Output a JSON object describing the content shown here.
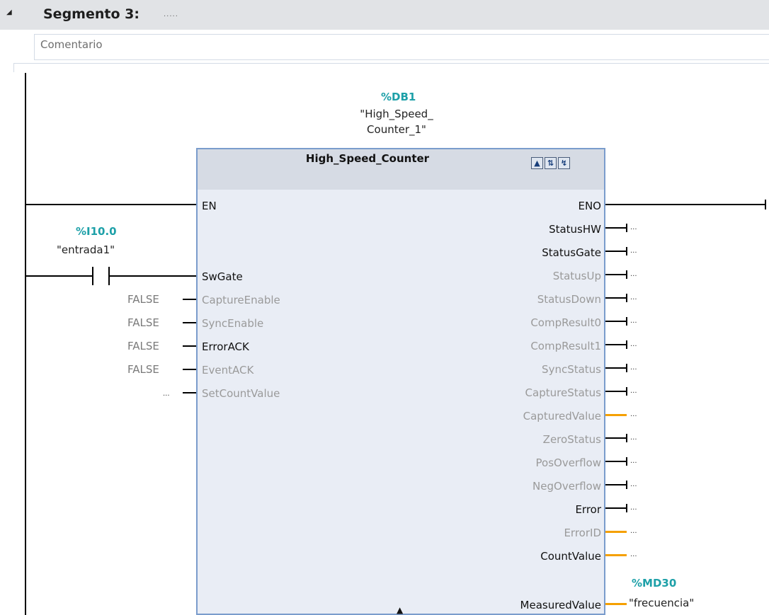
{
  "segment": {
    "title": "Segmento 3:",
    "subtitle": ".....",
    "comment": "Comentario"
  },
  "contact": {
    "address": "%I10.0",
    "name": "\"entrada1\""
  },
  "instance": {
    "address": "%DB1",
    "name_line1": "\"High_Speed_",
    "name_line2": "Counter_1\""
  },
  "block": {
    "title": "High_Speed_Counter",
    "inputs": [
      {
        "label": "EN",
        "value": ""
      },
      {
        "label": "SwGate",
        "value": ""
      },
      {
        "label": "CaptureEnable",
        "value": "FALSE"
      },
      {
        "label": "SyncEnable",
        "value": "FALSE"
      },
      {
        "label": "ErrorACK",
        "value": "FALSE"
      },
      {
        "label": "EventACK",
        "value": "FALSE"
      },
      {
        "label": "SetCountValue",
        "value": "..."
      }
    ],
    "outputs": [
      {
        "label": "ENO",
        "value": ""
      },
      {
        "label": "StatusHW",
        "value": "..."
      },
      {
        "label": "StatusGate",
        "value": "..."
      },
      {
        "label": "StatusUp",
        "value": "..."
      },
      {
        "label": "StatusDown",
        "value": "..."
      },
      {
        "label": "CompResult0",
        "value": "..."
      },
      {
        "label": "CompResult1",
        "value": "..."
      },
      {
        "label": "SyncStatus",
        "value": "..."
      },
      {
        "label": "CaptureStatus",
        "value": "..."
      },
      {
        "label": "CapturedValue",
        "value": "..."
      },
      {
        "label": "ZeroStatus",
        "value": "..."
      },
      {
        "label": "PosOverflow",
        "value": "..."
      },
      {
        "label": "NegOverflow",
        "value": "..."
      },
      {
        "label": "Error",
        "value": "..."
      },
      {
        "label": "ErrorID",
        "value": "..."
      },
      {
        "label": "CountValue",
        "value": "..."
      },
      {
        "label": "MeasuredValue",
        "value": ""
      }
    ]
  },
  "measured": {
    "address": "%MD30",
    "name": "\"frecuencia\""
  },
  "colors": {
    "tag_address": "#1da0a8",
    "block_border": "#7a9ccc",
    "block_fill": "#e9edf5",
    "wire_double": "#f5a000",
    "header_bg": "#e1e3e6"
  },
  "icons": [
    "collapse-triangle-icon",
    "instance-db-icon",
    "properties-icon",
    "diagnostics-icon",
    "expand-arrow-icon"
  ]
}
